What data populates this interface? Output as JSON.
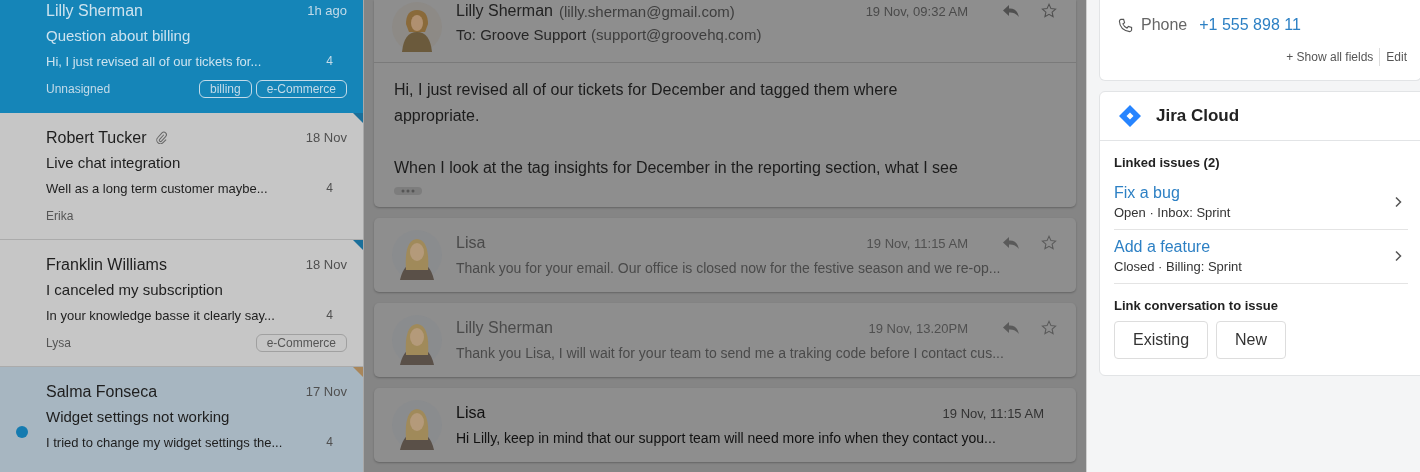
{
  "conversations": [
    {
      "name": "Lilly Sherman",
      "time": "1h ago",
      "subject": "Question about billing",
      "preview": "Hi, I just revised all of our tickets for...",
      "count": "4",
      "assignee": "Unnasigned",
      "tags": [
        "billing",
        "e-Commerce"
      ],
      "selected": true,
      "unread": false,
      "attachment": false
    },
    {
      "name": "Robert Tucker",
      "time": "18 Nov",
      "subject": "Live chat integration",
      "preview": "Well as a long term customer maybe...",
      "count": "4",
      "assignee": "Erika",
      "selected": false,
      "unread": false,
      "attachment": true,
      "color": "#1a6f9a"
    },
    {
      "name": "Franklin Williams",
      "time": "18 Nov",
      "subject": "I canceled my subscription",
      "preview": "In your knowledge basse it clearly say...",
      "count": "4",
      "assignee": "Lysa",
      "tags": [
        "e-Commerce"
      ],
      "selected": false,
      "unread": false,
      "attachment": false,
      "color": "#1a6f9a"
    },
    {
      "name": "Salma Fonseca",
      "time": "17 Nov",
      "subject": "Widget settings not working",
      "preview": "I tried to change my widget settings the...",
      "count": "4",
      "selected": false,
      "unread": true,
      "attachment": false,
      "color": "#a9865a"
    }
  ],
  "messages": [
    {
      "kind": "expanded",
      "sender": "Lilly Sherman",
      "email": "(lilly.sherman@gmail.com)",
      "to": "To: Groove Support",
      "to_email": "(support@groovehq.com)",
      "time": "19 Nov, 09:32 AM",
      "body": [
        "Hi, I just revised all of our tickets for December and tagged them where appropriate.",
        "When I look at the tag insights for December in the reporting section, what I see"
      ],
      "actions": true
    },
    {
      "kind": "collapsed",
      "sender": "Lisa",
      "time": "19 Nov, 11:15 AM",
      "preview": "Thank you for your email. Our office is closed now for the festive season and we re-op...",
      "actions": true,
      "read": true
    },
    {
      "kind": "collapsed",
      "sender": "Lilly Sherman",
      "time": "19 Nov, 13.20PM",
      "preview": "Thank you Lisa, I will wait for your team to send me a traking code before I contact cus...",
      "actions": true,
      "read": true
    },
    {
      "kind": "collapsed",
      "sender": "Lisa",
      "time": "19 Nov, 11:15 AM",
      "preview": "Hi Lilly, keep in mind that our support team will need more info when they contact you...",
      "actions": false,
      "read": false
    }
  ],
  "contact": {
    "phone_label": "Phone",
    "phone": "+1 555 898 11",
    "show_all": "+ Show all fields",
    "edit": "Edit"
  },
  "jira": {
    "title": "Jira Cloud",
    "linked_heading": "Linked issues (2)",
    "issues": [
      {
        "title": "Fix a bug",
        "meta": "Open · Inbox: Sprint"
      },
      {
        "title": "Add a feature",
        "meta": "Closed · Billing: Sprint"
      }
    ],
    "link_heading": "Link conversation to issue",
    "buttons": [
      "Existing",
      "New"
    ]
  }
}
